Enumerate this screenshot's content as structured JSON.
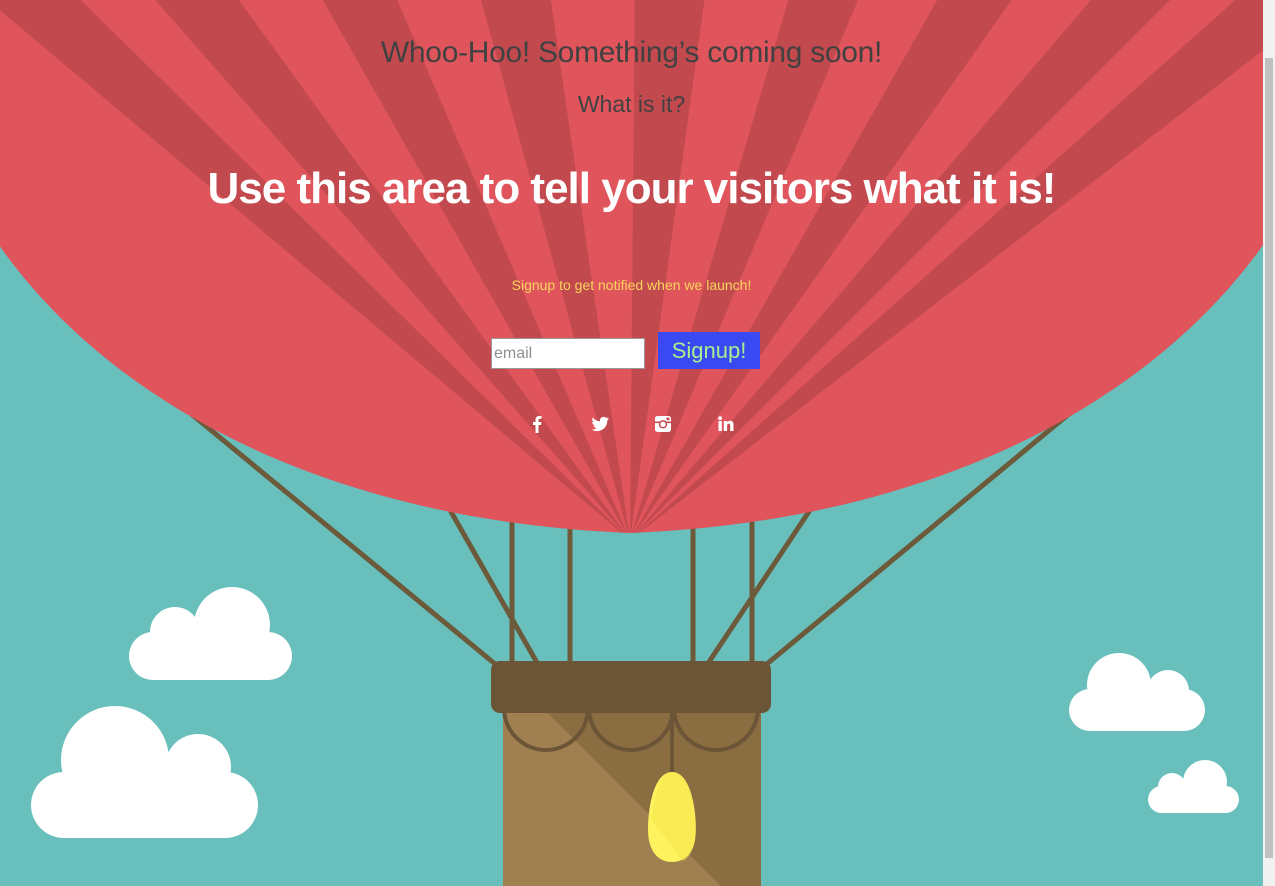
{
  "page": {
    "kicker": "Whoo-Hoo! Something’s coming soon!",
    "subkicker": "What is it?",
    "headline": "Use this area to tell your visitors what it is!",
    "notify_text": "Signup to get notified when we launch!"
  },
  "form": {
    "email_placeholder": "email",
    "email_value": "",
    "signup_label": "Signup!"
  },
  "social": {
    "icons": [
      "facebook-icon",
      "twitter-icon",
      "instagram-icon",
      "linkedin-icon"
    ]
  },
  "colors": {
    "sky": "#68bfbc",
    "balloon_light": "#e0555c",
    "balloon_dark": "#c24a4f",
    "basket": "#a08051",
    "basket_rim": "#6c5536",
    "ropes": "#6c5a3a",
    "flame": "#fef35e",
    "cloud": "#ffffff",
    "signup_bg": "#3a49f1",
    "signup_text": "#a8f08f",
    "notify_text": "#f8d45b"
  }
}
